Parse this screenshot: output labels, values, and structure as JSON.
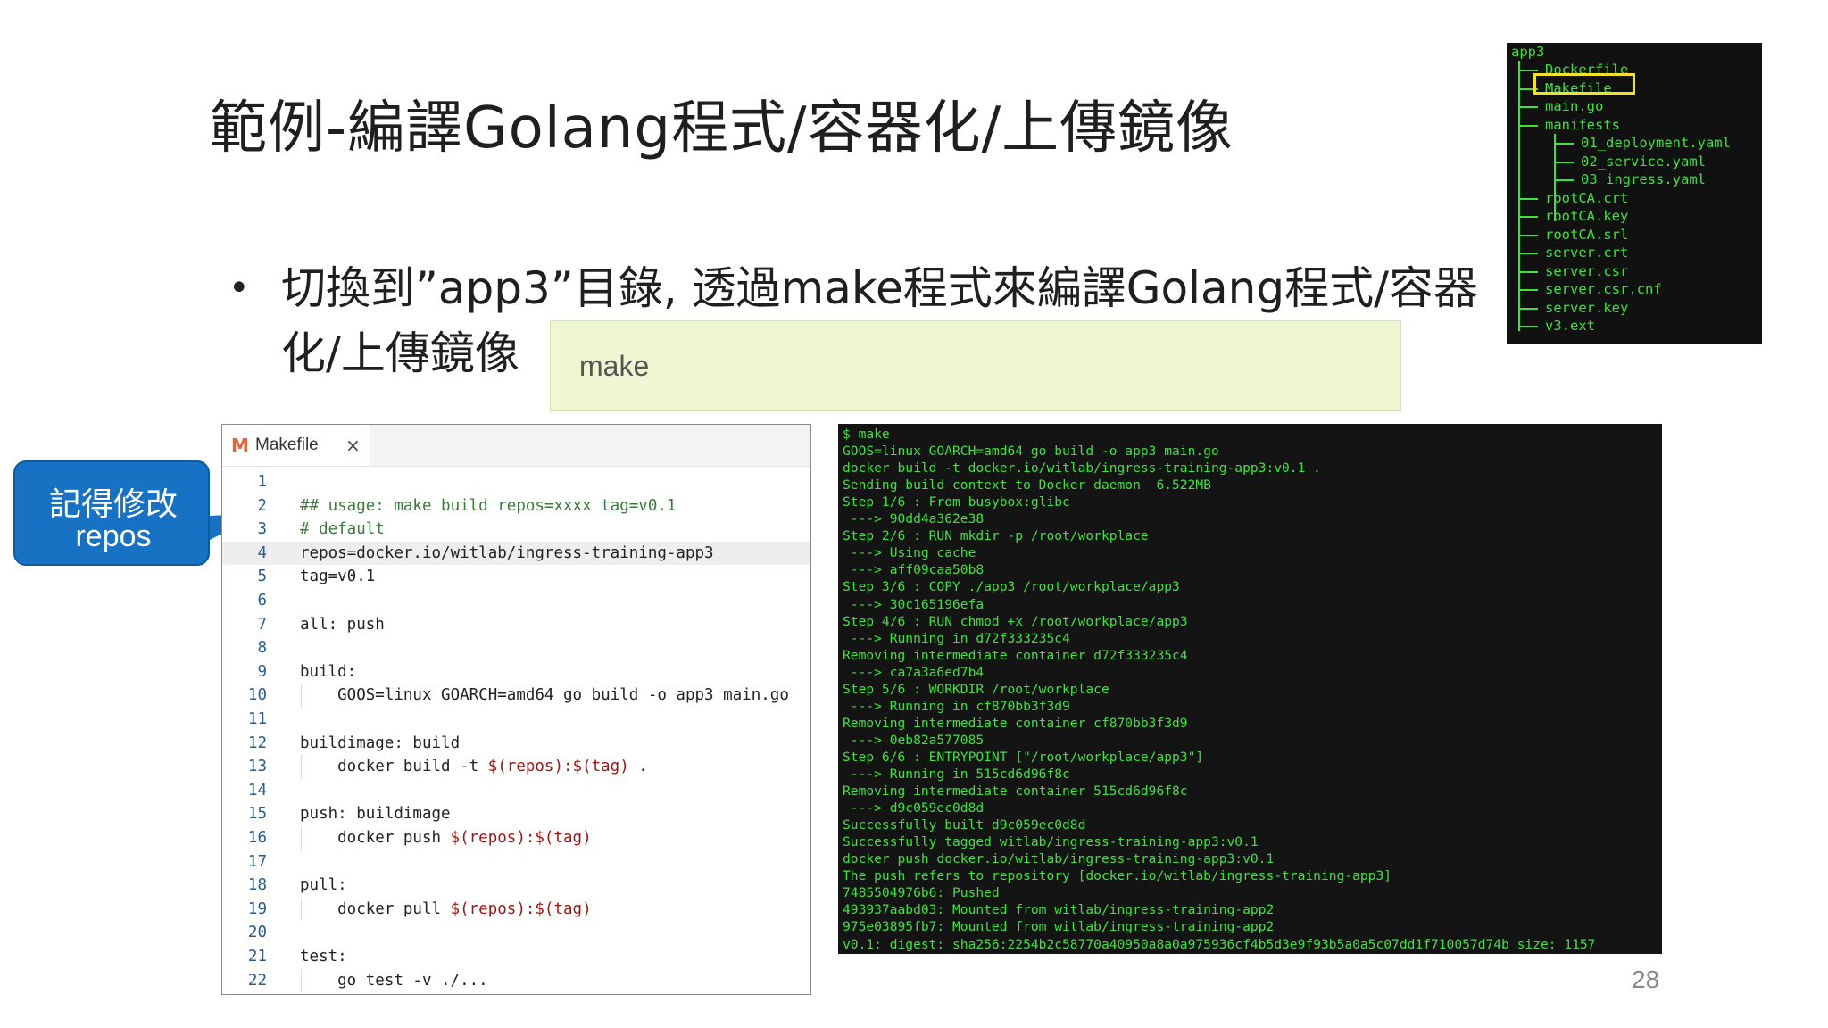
{
  "slide": {
    "title": "範例-編譯Golang程式/容器化/上傳鏡像",
    "bullet_line1": "切換到”app3”目錄, 透過make程式來編譯Golang程式/容器",
    "bullet_line2": "化/上傳鏡像",
    "command": "make",
    "page_number": "28"
  },
  "callout": {
    "line1": "記得修改",
    "line2": "repos",
    "color": "#1772c4"
  },
  "tree": {
    "root": "app3",
    "items": [
      "Dockerfile",
      "Makefile",
      "main.go",
      "manifests",
      "01_deployment.yaml",
      "02_service.yaml",
      "03_ingress.yaml",
      "rootCA.crt",
      "rootCA.key",
      "rootCA.srl",
      "server.crt",
      "server.csr",
      "server.csr.cnf",
      "server.key",
      "v3.ext"
    ],
    "highlighted": "Makefile"
  },
  "editor": {
    "tab_icon": "M",
    "tab_label": "Makefile",
    "close_glyph": "×",
    "lines": [
      {
        "n": "1",
        "t": ""
      },
      {
        "n": "2",
        "t": "## usage: make build repos=xxxx tag=v0.1"
      },
      {
        "n": "3",
        "t": "# default"
      },
      {
        "n": "4",
        "t": "repos=docker.io/witlab/ingress-training-app3"
      },
      {
        "n": "5",
        "t": "tag=v0.1"
      },
      {
        "n": "6",
        "t": ""
      },
      {
        "n": "7",
        "t": "all: push"
      },
      {
        "n": "8",
        "t": ""
      },
      {
        "n": "9",
        "t": "build:"
      },
      {
        "n": "10",
        "t": "    GOOS=linux GOARCH=amd64 go build -o app3 main.go"
      },
      {
        "n": "11",
        "t": ""
      },
      {
        "n": "12",
        "t": "buildimage: build"
      },
      {
        "n": "13",
        "t": "    docker build -t ",
        "v": "$(repos):$(tag)",
        "s": " ."
      },
      {
        "n": "14",
        "t": ""
      },
      {
        "n": "15",
        "t": "push: buildimage"
      },
      {
        "n": "16",
        "t": "    docker push ",
        "v": "$(repos):$(tag)"
      },
      {
        "n": "17",
        "t": ""
      },
      {
        "n": "18",
        "t": "pull:"
      },
      {
        "n": "19",
        "t": "    docker pull ",
        "v": "$(repos):$(tag)"
      },
      {
        "n": "20",
        "t": ""
      },
      {
        "n": "21",
        "t": "test:"
      },
      {
        "n": "22",
        "t": "    go test -v ./..."
      }
    ]
  },
  "terminal": {
    "lines": [
      "$ make",
      "GOOS=linux GOARCH=amd64 go build -o app3 main.go",
      "docker build -t docker.io/witlab/ingress-training-app3:v0.1 .",
      "Sending build context to Docker daemon  6.522MB",
      "Step 1/6 : From busybox:glibc",
      " ---> 90dd4a362e38",
      "Step 2/6 : RUN mkdir -p /root/workplace",
      " ---> Using cache",
      " ---> aff09caa50b8",
      "Step 3/6 : COPY ./app3 /root/workplace/app3",
      " ---> 30c165196efa",
      "Step 4/6 : RUN chmod +x /root/workplace/app3",
      " ---> Running in d72f333235c4",
      "Removing intermediate container d72f333235c4",
      " ---> ca7a3a6ed7b4",
      "Step 5/6 : WORKDIR /root/workplace",
      " ---> Running in cf870bb3f3d9",
      "Removing intermediate container cf870bb3f3d9",
      " ---> 0eb82a577085",
      "Step 6/6 : ENTRYPOINT [\"/root/workplace/app3\"]",
      " ---> Running in 515cd6d96f8c",
      "Removing intermediate container 515cd6d96f8c",
      " ---> d9c059ec0d8d",
      "Successfully built d9c059ec0d8d",
      "Successfully tagged witlab/ingress-training-app3:v0.1",
      "docker push docker.io/witlab/ingress-training-app3:v0.1",
      "The push refers to repository [docker.io/witlab/ingress-training-app3]",
      "7485504976b6: Pushed",
      "493937aabd03: Mounted from witlab/ingress-training-app2",
      "975e03895fb7: Mounted from witlab/ingress-training-app2",
      "v0.1: digest: sha256:2254b2c58770a40950a8a0a975936cf4b5d3e9f93b5a0a5c07dd1f710057d74b size: 1157"
    ]
  }
}
